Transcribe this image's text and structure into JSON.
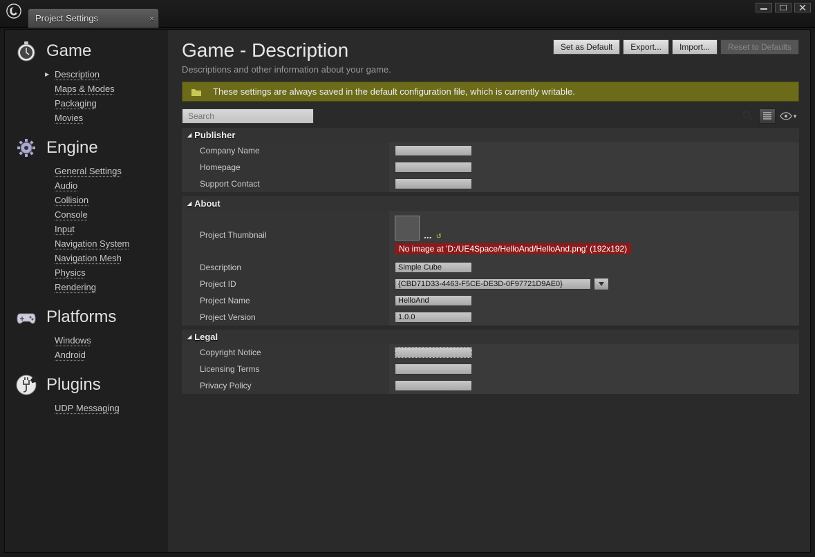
{
  "window": {
    "tab_title": "Project Settings"
  },
  "sidebar": [
    {
      "name": "Game",
      "icon": "stopwatch",
      "items": [
        {
          "label": "Description",
          "active": true
        },
        {
          "label": "Maps & Modes"
        },
        {
          "label": "Packaging"
        },
        {
          "label": "Movies"
        }
      ]
    },
    {
      "name": "Engine",
      "icon": "gear",
      "items": [
        {
          "label": "General Settings"
        },
        {
          "label": "Audio"
        },
        {
          "label": "Collision"
        },
        {
          "label": "Console"
        },
        {
          "label": "Input"
        },
        {
          "label": "Navigation System"
        },
        {
          "label": "Navigation Mesh"
        },
        {
          "label": "Physics"
        },
        {
          "label": "Rendering"
        }
      ]
    },
    {
      "name": "Platforms",
      "icon": "gamepad",
      "items": [
        {
          "label": "Windows"
        },
        {
          "label": "Android"
        }
      ]
    },
    {
      "name": "Plugins",
      "icon": "plug",
      "items": [
        {
          "label": "UDP Messaging"
        }
      ]
    }
  ],
  "header": {
    "title": "Game - Description",
    "subtitle": "Descriptions and other information about your game.",
    "buttons": {
      "set_default": "Set as Default",
      "export": "Export...",
      "import": "Import...",
      "reset": "Reset to Defaults"
    }
  },
  "banner": "These settings are always saved in the default configuration file, which is currently writable.",
  "search": {
    "placeholder": "Search"
  },
  "sections": [
    {
      "title": "Publisher",
      "rows": [
        {
          "label": "Company Name",
          "type": "text",
          "value": ""
        },
        {
          "label": "Homepage",
          "type": "text",
          "value": ""
        },
        {
          "label": "Support Contact",
          "type": "text",
          "value": ""
        }
      ]
    },
    {
      "title": "About",
      "rows": [
        {
          "label": "Project Thumbnail",
          "type": "thumb",
          "error": "No image at 'D:/UE4Space/HelloAnd/HelloAnd.png' (192x192)"
        },
        {
          "label": "Description",
          "type": "text",
          "value": "Simple Cube"
        },
        {
          "label": "Project ID",
          "type": "dropdown",
          "value": "{CBD71D33-4463-F5CE-DE3D-0F97721D9AE0}"
        },
        {
          "label": "Project Name",
          "type": "text",
          "value": "HelloAnd"
        },
        {
          "label": "Project Version",
          "type": "text",
          "value": "1.0.0"
        }
      ]
    },
    {
      "title": "Legal",
      "rows": [
        {
          "label": "Copyright Notice",
          "type": "copy",
          "value": ""
        },
        {
          "label": "Licensing Terms",
          "type": "text",
          "value": ""
        },
        {
          "label": "Privacy Policy",
          "type": "text",
          "value": ""
        }
      ]
    }
  ]
}
